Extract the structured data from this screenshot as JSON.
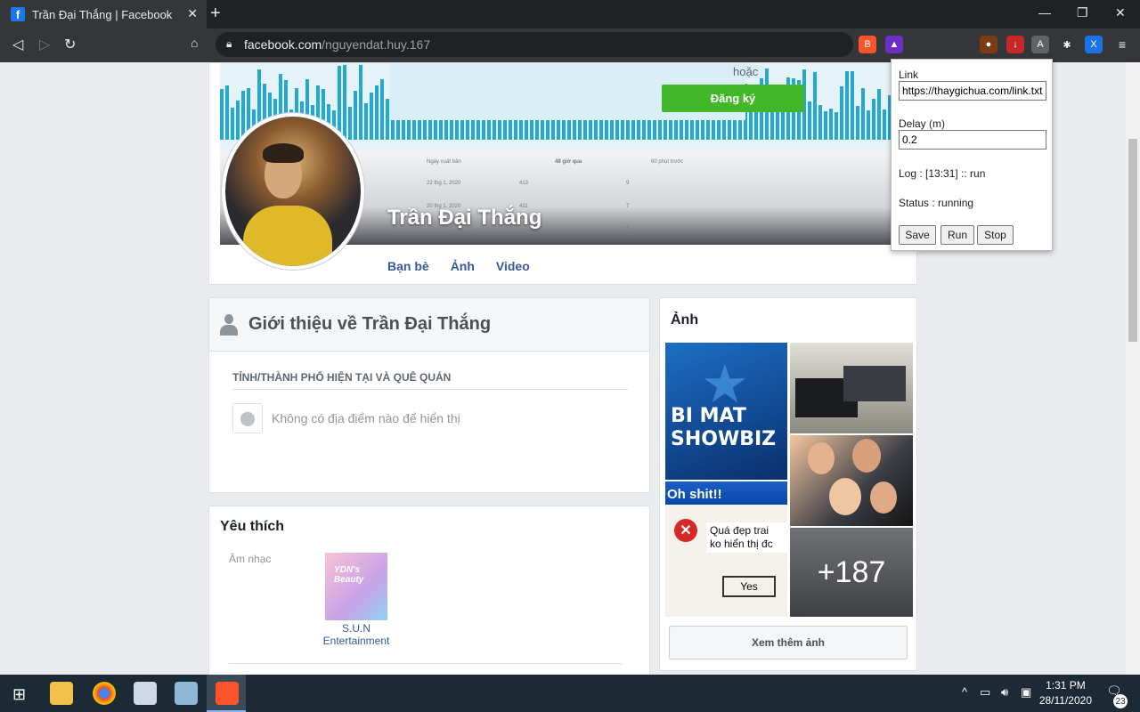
{
  "browser": {
    "tab_title": "Trần Đại Thắng | Facebook",
    "url_host": "facebook.com",
    "url_path": "/nguyendat.huy.167"
  },
  "cover": {
    "or_text": "hoặc",
    "signup_button": "Đăng ký",
    "profile_name": "Trần Đại Thắng",
    "table_headers": [
      "Ngày xuất bản",
      "48 giờ qua",
      "60 phút trước"
    ],
    "table_rows": [
      {
        "date": "22 thg 1, 2020",
        "v48": "413",
        "v60": "9"
      },
      {
        "date": "20 thg 1, 2020",
        "v48": "411",
        "v60": "7"
      },
      {
        "date": "",
        "v48": "",
        "v60": "4"
      }
    ]
  },
  "profile_tabs": [
    "Bạn bè",
    "Ảnh",
    "Video"
  ],
  "intro": {
    "title": "Giới thiệu về Trần Đại Thắng",
    "section_title": "TỈNH/THÀNH PHỐ HIỆN TẠI VÀ QUÊ QUÁN",
    "empty_text": "Không có địa điểm nào để hiển thị"
  },
  "favorites": {
    "title": "Yêu thích",
    "category": "Âm nhạc",
    "item_name_line1": "S.U.N",
    "item_name_line2": "Entertainment"
  },
  "photos": {
    "title": "Ảnh",
    "tile1_line1": "BI MAT",
    "tile1_line2": "SHOWBIZ",
    "tile3_title": "Oh shit!!",
    "tile3_msg_line1": "Quá đẹp trai",
    "tile3_msg_line2": "ko hiển thị đc",
    "tile3_button": "Yes",
    "more_count": "+187",
    "see_more": "Xem thêm ảnh"
  },
  "extension_popup": {
    "link_label": "Link",
    "link_value": "https://thaygichua.com/link.txt",
    "delay_label": "Delay (m)",
    "delay_value": "0.2",
    "log_text": "Log : [13:31] :: run",
    "status_text": "Status : running",
    "save": "Save",
    "run": "Run",
    "stop": "Stop"
  },
  "taskbar": {
    "time": "1:31 PM",
    "date": "28/11/2020",
    "notif_count": "23"
  }
}
